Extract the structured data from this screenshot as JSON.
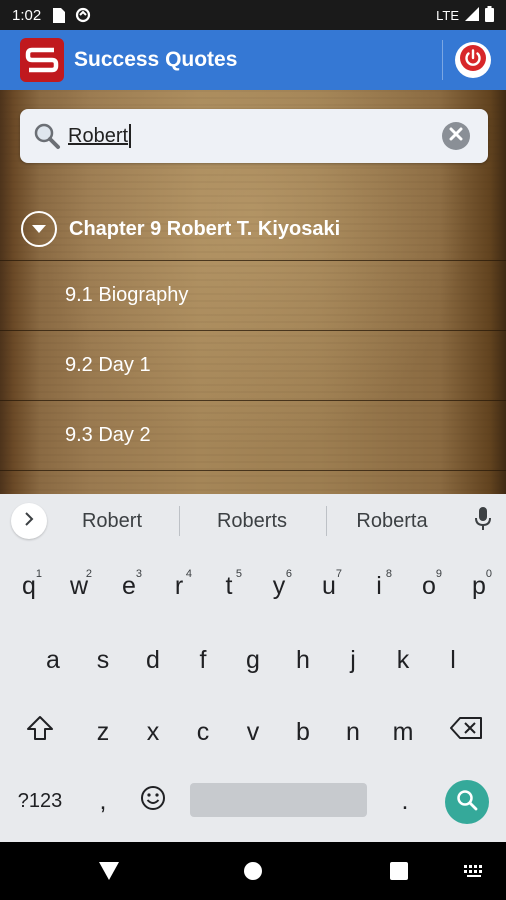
{
  "status_bar": {
    "time": "1:02",
    "network": "LTE",
    "icons": [
      "sim-card-icon",
      "data-saver-icon",
      "signal-icon",
      "battery-icon"
    ]
  },
  "app_bar": {
    "title": "Success Quotes",
    "logo_icon": "success-quotes-logo",
    "power_icon": "power-icon",
    "color": "#3578d4"
  },
  "search": {
    "value": "Robert",
    "search_icon": "search-icon",
    "clear_icon": "clear-icon"
  },
  "results": {
    "chapter": {
      "title": "Chapter 9 Robert T. Kiyosaki",
      "expanded": true
    },
    "items": [
      {
        "label": "9.1 Biography"
      },
      {
        "label": "9.2 Day 1"
      },
      {
        "label": "9.3 Day 2"
      }
    ]
  },
  "keyboard": {
    "suggestions": [
      "Robert",
      "Roberts",
      "Roberta"
    ],
    "row1": [
      {
        "k": "q",
        "h": "1"
      },
      {
        "k": "w",
        "h": "2"
      },
      {
        "k": "e",
        "h": "3"
      },
      {
        "k": "r",
        "h": "4"
      },
      {
        "k": "t",
        "h": "5"
      },
      {
        "k": "y",
        "h": "6"
      },
      {
        "k": "u",
        "h": "7"
      },
      {
        "k": "i",
        "h": "8"
      },
      {
        "k": "o",
        "h": "9"
      },
      {
        "k": "p",
        "h": "0"
      }
    ],
    "row2": [
      "a",
      "s",
      "d",
      "f",
      "g",
      "h",
      "j",
      "k",
      "l"
    ],
    "row3": [
      "z",
      "x",
      "c",
      "v",
      "b",
      "n",
      "m"
    ],
    "row4": {
      "symbols": "?123",
      "comma": ",",
      "period": "."
    },
    "accent_color": "#35a99a"
  },
  "nav_bar": {
    "icons": [
      "back-icon",
      "home-icon",
      "recents-icon",
      "keyboard-switch-icon"
    ]
  }
}
